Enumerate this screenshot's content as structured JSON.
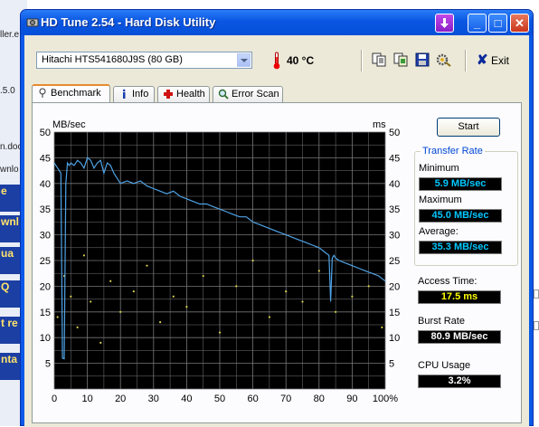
{
  "background": {
    "lines": [
      "ller.e",
      ".5.0",
      "n.doc",
      "wnlo"
    ],
    "blue_items": [
      "e",
      "wnl",
      "ua",
      "Q",
      "t re",
      "nta"
    ]
  },
  "window": {
    "title": "HD Tune 2.54 - Hard Disk Utility",
    "minimize": "_",
    "maximize": "□",
    "close": "✕"
  },
  "toolbar": {
    "drive": "Hitachi HTS541680J9S (80 GB)",
    "temperature": "40 °C",
    "exit_label": "Exit",
    "icons": [
      "copy-info-icon",
      "copy-screenshot-icon",
      "save-icon",
      "options-icon"
    ]
  },
  "tabs": [
    {
      "label": "Benchmark",
      "icon": "benchmark-icon",
      "active": true
    },
    {
      "label": "Info",
      "icon": "info-icon",
      "active": false
    },
    {
      "label": "Health",
      "icon": "health-icon",
      "active": false
    },
    {
      "label": "Error Scan",
      "icon": "error-scan-icon",
      "active": false
    }
  ],
  "benchmark": {
    "start_label": "Start",
    "transfer_rate": {
      "title": "Transfer Rate",
      "minimum_label": "Minimum",
      "minimum": "5.9 MB/sec",
      "maximum_label": "Maximum",
      "maximum": "45.0 MB/sec",
      "average_label": "Average:",
      "average": "35.3 MB/sec"
    },
    "access_time_label": "Access Time:",
    "access_time": "17.5 ms",
    "burst_rate_label": "Burst Rate",
    "burst_rate": "80.9 MB/sec",
    "cpu_usage_label": "CPU Usage",
    "cpu_usage": "3.2%"
  },
  "chart_data": {
    "type": "line",
    "ylabel_left": "MB/sec",
    "ylabel_right": "ms",
    "x_ticks": [
      "0",
      "10",
      "20",
      "30",
      "40",
      "50",
      "60",
      "70",
      "80",
      "90",
      "100%"
    ],
    "y_ticks": [
      "5",
      "10",
      "15",
      "20",
      "25",
      "30",
      "35",
      "40",
      "45",
      "50"
    ],
    "xlim": [
      0,
      100
    ],
    "ylim": [
      0,
      50
    ],
    "grid": true,
    "colors": {
      "background": "#000000",
      "grid": "#777777",
      "transfer": "#4fa3e6",
      "access": "#d8d050"
    },
    "series": [
      {
        "name": "Transfer Rate",
        "x": [
          0,
          0.5,
          1,
          1.5,
          2,
          2.5,
          3,
          3.5,
          4,
          4.5,
          5,
          6,
          7,
          8,
          9,
          10,
          11,
          12,
          13,
          14,
          15,
          16,
          17,
          18,
          19,
          20,
          22,
          24,
          26,
          28,
          30,
          32,
          34,
          36,
          38,
          40,
          42,
          44,
          46,
          48,
          50,
          52,
          54,
          56,
          58,
          60,
          62,
          64,
          66,
          68,
          70,
          72,
          74,
          76,
          78,
          80,
          81,
          82,
          83,
          83.5,
          84,
          84.5,
          85,
          86,
          88,
          90,
          92,
          94,
          96,
          98,
          100
        ],
        "y": [
          44,
          43.5,
          43,
          42.5,
          42,
          6,
          5.9,
          40,
          44,
          43.5,
          44,
          43.5,
          44.5,
          44,
          43,
          45,
          44.5,
          43,
          44,
          44.5,
          42,
          44,
          43.5,
          42,
          41,
          40,
          40.5,
          40,
          40.5,
          39.5,
          39,
          38.5,
          38,
          38.5,
          37.5,
          37,
          36.5,
          36,
          36,
          35.5,
          35,
          34.5,
          34,
          33.5,
          33.5,
          32.5,
          32,
          31.5,
          31,
          30.5,
          30,
          29.5,
          29,
          28.5,
          28,
          27.5,
          27,
          26.5,
          26,
          17,
          25.5,
          26,
          25.5,
          25,
          24.5,
          24,
          23.5,
          23,
          22.5,
          22,
          21
        ]
      },
      {
        "name": "Access Time",
        "x": [
          1,
          3,
          5,
          7,
          9,
          11,
          14,
          17,
          20,
          24,
          28,
          32,
          36,
          40,
          45,
          50,
          55,
          60,
          65,
          70,
          75,
          80,
          85,
          90,
          95,
          99
        ],
        "y": [
          14,
          22,
          18,
          12,
          26,
          17,
          9,
          21,
          15,
          19,
          24,
          13,
          18,
          16,
          22,
          11,
          20,
          25,
          14,
          19,
          17,
          23,
          15,
          18,
          20,
          12
        ]
      }
    ]
  }
}
